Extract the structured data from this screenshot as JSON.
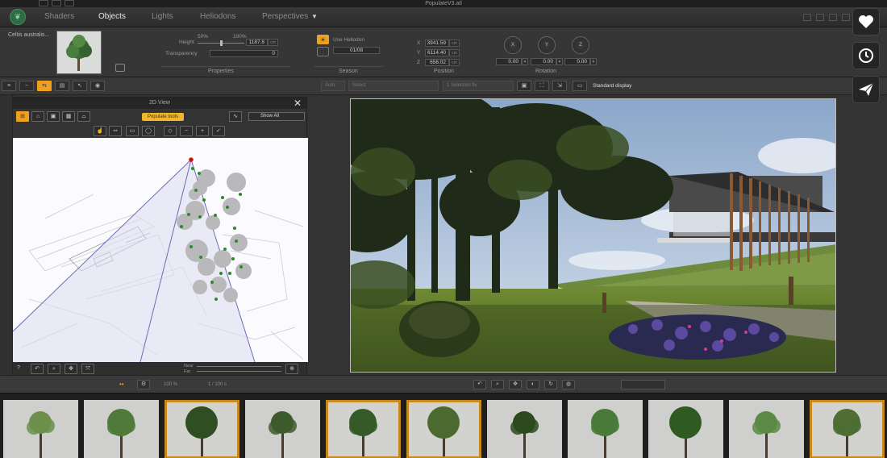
{
  "window": {
    "title": "PopulateV3.atl"
  },
  "tabs": [
    {
      "label": "Shaders",
      "active": false
    },
    {
      "label": "Objects",
      "active": true
    },
    {
      "label": "Lights",
      "active": false
    },
    {
      "label": "Heliodons",
      "active": false
    },
    {
      "label": "Perspectives",
      "active": false
    }
  ],
  "properties": {
    "object_name": "Celtis australis...",
    "height_label": "Height",
    "height_value": "1187.8",
    "height_unit": "cm",
    "slider_min": "50%",
    "slider_max": "100%",
    "transparency_label": "Transparency",
    "transparency_value": "0",
    "group_label": "Properties"
  },
  "season": {
    "use_heliodon_label": "Use Heliodon",
    "date_value": "01/08",
    "group_label": "Season"
  },
  "position": {
    "x_label": "X",
    "x_value": "3941.59",
    "y_label": "Y",
    "y_value": "6114.40",
    "z_label": "Z",
    "z_value": "656.02",
    "unit": "cm",
    "group_label": "Position"
  },
  "rotation": {
    "dials": [
      "X",
      "Y",
      "Z"
    ],
    "values": [
      "0.00",
      "0.00",
      "0.00"
    ],
    "group_label": "Rotation"
  },
  "toolbar2": {
    "auto_label": "Auto",
    "field1": "Select",
    "field2": "1 Selection fix",
    "standard_display": "Standard display"
  },
  "panel2d": {
    "title": "2D View",
    "populate_tools": "Populate tools",
    "show_all": "Show All",
    "near_label": "Near",
    "far_label": "Far",
    "help": "?"
  },
  "bottombar": {
    "zoom_text": "100 %",
    "ratio_text": "1 / 100 s"
  },
  "colors": {
    "accent": "#f0a020",
    "selection": "#c68a1c",
    "logo": "#2f6b44"
  },
  "library": {
    "tiles": [
      {
        "selected": false
      },
      {
        "selected": false
      },
      {
        "selected": true
      },
      {
        "selected": false
      },
      {
        "selected": true
      },
      {
        "selected": true
      },
      {
        "selected": false
      },
      {
        "selected": false
      },
      {
        "selected": false
      },
      {
        "selected": false
      },
      {
        "selected": true
      }
    ]
  },
  "fab": [
    {
      "icon": "heart-icon"
    },
    {
      "icon": "clock-icon"
    },
    {
      "icon": "send-icon"
    }
  ]
}
